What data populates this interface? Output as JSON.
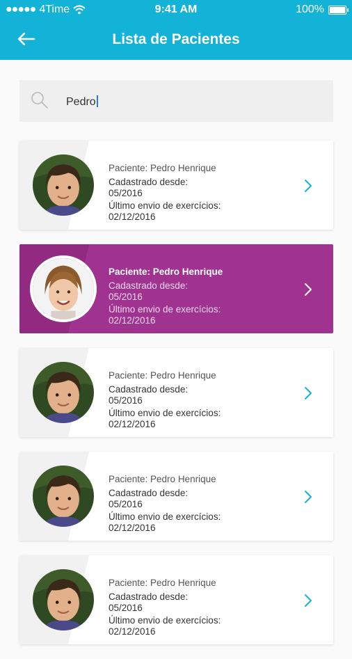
{
  "status_bar": {
    "carrier": "4Time",
    "time": "9:41 AM",
    "battery": "100%",
    "battery_level": 1.0
  },
  "header": {
    "title": "Lista de Pacientes",
    "back_icon": "arrow-left-icon"
  },
  "search": {
    "value": "Pedro",
    "icon": "search-icon"
  },
  "patients": [
    {
      "name": "Paciente: Pedro Henrique",
      "registered_label": "Cadastrado desde:",
      "registered": "05/2016",
      "last_label": "Último envio de exercícios:",
      "last": "02/12/2016",
      "selected": false
    },
    {
      "name": "Paciente: Pedro Henrique",
      "registered_label": "Cadastrado desde:",
      "registered": "05/2016",
      "last_label": "Último envio de exercícios:",
      "last": "02/12/2016",
      "selected": true
    },
    {
      "name": "Paciente: Pedro Henrique",
      "registered_label": "Cadastrado desde:",
      "registered": "05/2016",
      "last_label": "Último envio de exercícios:",
      "last": "02/12/2016",
      "selected": false
    },
    {
      "name": "Paciente: Pedro Henrique",
      "registered_label": "Cadastrado desde:",
      "registered": "05/2016",
      "last_label": "Último envio de exercícios:",
      "last": "02/12/2016",
      "selected": false
    },
    {
      "name": "Paciente: Pedro Henrique",
      "registered_label": "Cadastrado desde:",
      "registered": "05/2016",
      "last_label": "Último envio de exercícios:",
      "last": "02/12/2016",
      "selected": false
    }
  ],
  "colors": {
    "header": "#12b3d6",
    "selected_card": "#a0338f",
    "chevron": "#12b3d6"
  }
}
